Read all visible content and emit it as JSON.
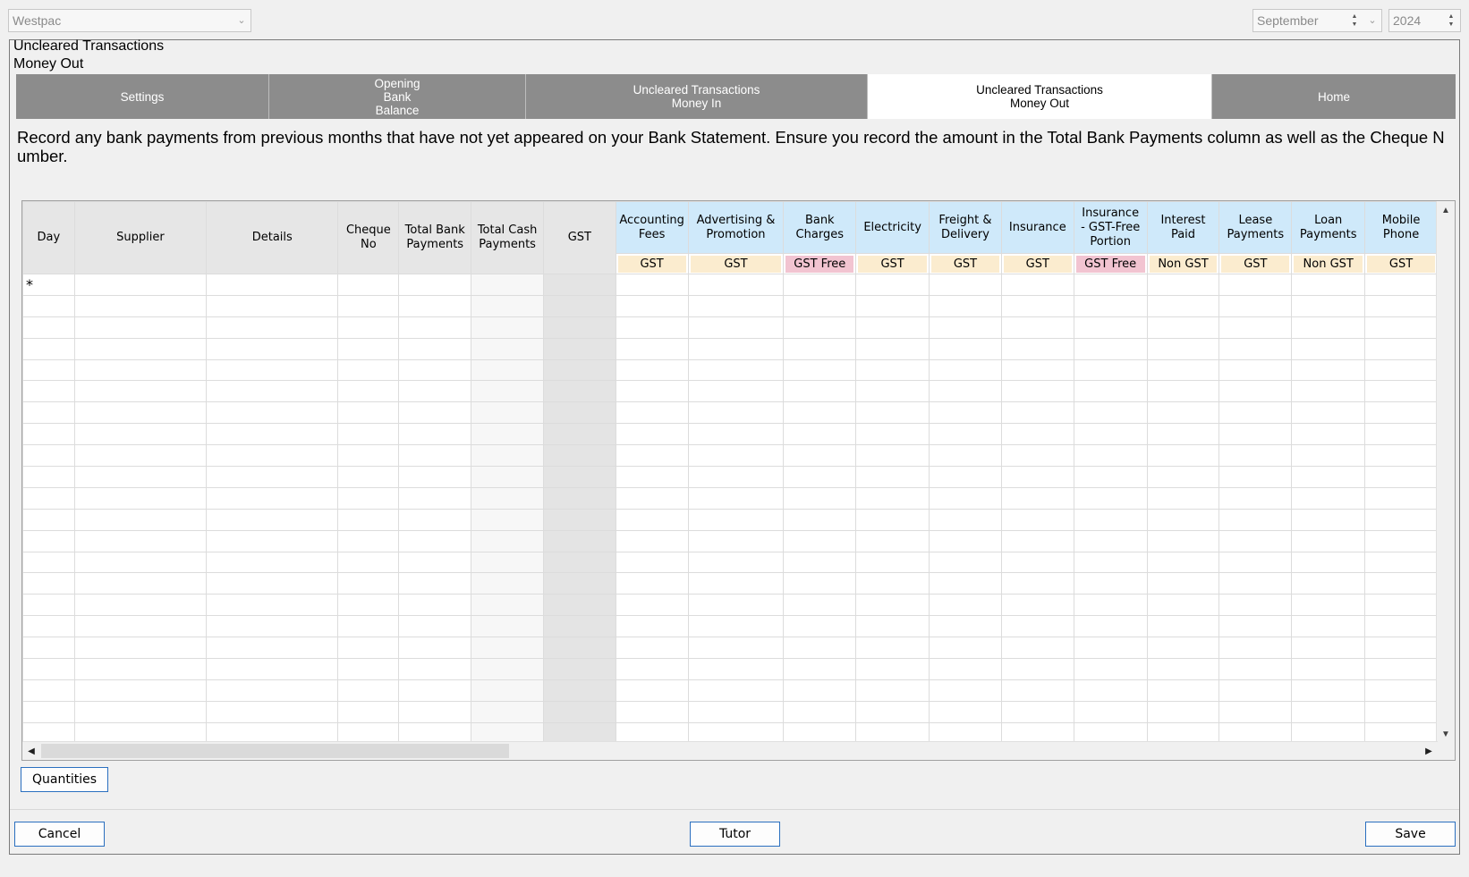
{
  "bank_select": {
    "value": "Westpac"
  },
  "month_select": {
    "value": "September"
  },
  "year_select": {
    "value": "2024"
  },
  "title": {
    "line1": "Uncleared Transactions",
    "line2": "Money Out"
  },
  "tabs": [
    {
      "label": "Settings",
      "active": false
    },
    {
      "label": "Opening\nBank\nBalance",
      "active": false
    },
    {
      "label": "Uncleared Transactions\nMoney In",
      "active": false
    },
    {
      "label": "Uncleared Transactions\nMoney Out",
      "active": true
    },
    {
      "label": "Home",
      "active": false
    }
  ],
  "instructions": "Record any bank payments from previous months that have not yet appeared on your Bank Statement. Ensure you record the amount in the Total Bank Payments column as well as the Cheque Number.",
  "grid": {
    "fixed_columns": [
      "Day",
      "Supplier",
      "Details",
      "Cheque\nNo",
      "Total Bank\nPayments",
      "Total Cash\nPayments",
      "GST"
    ],
    "account_columns": [
      {
        "label": "Accounting\nFees",
        "tax": "GST"
      },
      {
        "label": "Advertising &\nPromotion",
        "tax": "GST"
      },
      {
        "label": "Bank\nCharges",
        "tax": "GST Free"
      },
      {
        "label": "Electricity",
        "tax": "GST"
      },
      {
        "label": "Freight &\nDelivery",
        "tax": "GST"
      },
      {
        "label": "Insurance",
        "tax": "GST"
      },
      {
        "label": "Insurance\n- GST-Free\nPortion",
        "tax": "GST Free"
      },
      {
        "label": "Interest\nPaid",
        "tax": "Non GST"
      },
      {
        "label": "Lease\nPayments",
        "tax": "GST"
      },
      {
        "label": "Loan\nPayments",
        "tax": "Non GST"
      },
      {
        "label": "Mobile\nPhone",
        "tax": "GST"
      }
    ],
    "new_row_marker": "*",
    "row_count": 22
  },
  "buttons": {
    "quantities": "Quantities",
    "cancel": "Cancel",
    "tutor": "Tutor",
    "save": "Save"
  }
}
